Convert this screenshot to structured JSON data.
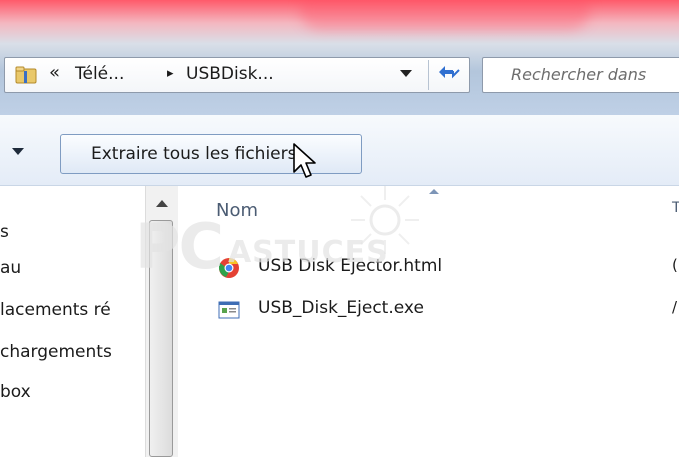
{
  "address": {
    "crumbs_prefix": "«",
    "segment1": "Télé...",
    "separator": "▸",
    "segment2": "USBDisk..."
  },
  "search": {
    "placeholder": "Rechercher dans"
  },
  "toolbar": {
    "extract_label": "Extraire tous les fichiers"
  },
  "nav": {
    "items": [
      {
        "label": "s"
      },
      {
        "label": "au"
      },
      {
        "label": "lacements ré"
      },
      {
        "label": "chargements"
      },
      {
        "label": "box"
      }
    ]
  },
  "content": {
    "column_name": "Nom",
    "column_edge": "T",
    "files": [
      {
        "name": "USB Disk Ejector.html",
        "icon": "chrome-html-icon",
        "right_char": "("
      },
      {
        "name": "USB_Disk_Eject.exe",
        "icon": "exe-app-icon",
        "right_char": "/"
      }
    ]
  },
  "watermark": {
    "big": "PC",
    "small": "ASTUCES"
  }
}
